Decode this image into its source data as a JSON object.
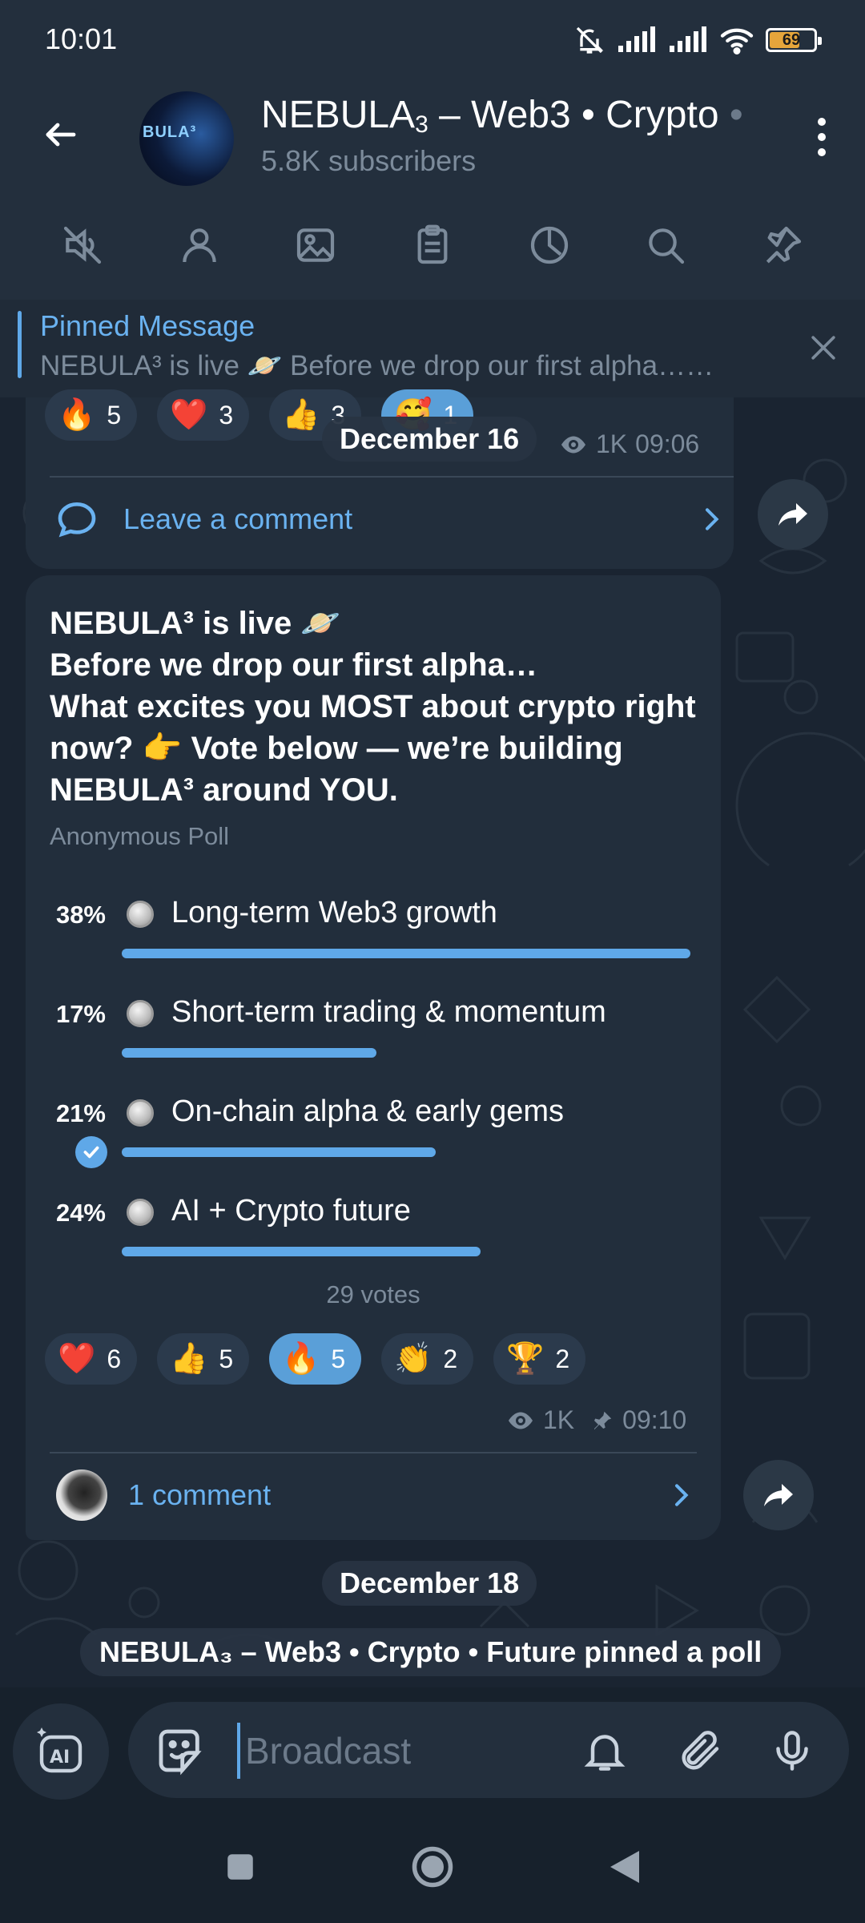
{
  "status_bar": {
    "time": "10:01",
    "battery": "69",
    "battery_level": 0.69
  },
  "channel": {
    "avatar_text": "BULA³",
    "name": "NEBULA",
    "name_sub": "3",
    "name_rest": " – Web3 • Crypto",
    "name_fade": " •",
    "subscribers": "5.8K subscribers"
  },
  "tabs": [
    "mute-icon",
    "members-icon",
    "media-icon",
    "files-icon",
    "stats-icon",
    "search-icon",
    "pin-icon"
  ],
  "pinned": {
    "title": "Pinned Message",
    "text": "NEBULA³ is live 🪐 Before we drop our first alpha……"
  },
  "prev_message": {
    "reactions": [
      {
        "emoji": "🔥",
        "count": "5"
      },
      {
        "emoji": "❤️",
        "count": "3"
      },
      {
        "emoji": "👍",
        "count": "3"
      },
      {
        "emoji": "🥰",
        "count": "1"
      }
    ],
    "date_chip": "December 16",
    "views": "1K",
    "time": "09:06",
    "comment_label": "Leave a comment"
  },
  "poll": {
    "question": "NEBULA³ is live 🪐\nBefore we drop our first alpha…\n What excites you MOST about crypto right now? 👉 Vote below — we’re building NEBULA³ around YOU.",
    "type": "Anonymous Poll",
    "options": [
      {
        "pct": "38%",
        "text": "Long-term Web3 growth",
        "value": 38
      },
      {
        "pct": "17%",
        "text": "Short-term trading & momentum",
        "value": 17
      },
      {
        "pct": "21%",
        "text": "On-chain alpha & early gems",
        "value": 21,
        "chosen": true
      },
      {
        "pct": "24%",
        "text": "AI + Crypto future",
        "value": 24
      }
    ],
    "votes": "29 votes",
    "reactions": [
      {
        "emoji": "❤️",
        "count": "6"
      },
      {
        "emoji": "👍",
        "count": "5"
      },
      {
        "emoji": "🔥",
        "count": "5",
        "active": true
      },
      {
        "emoji": "👏",
        "count": "2"
      },
      {
        "emoji": "🏆",
        "count": "2"
      }
    ],
    "views": "1K",
    "time": "09:10",
    "comment_label": "1 comment"
  },
  "date_chip_2": "December 18",
  "service_message": "NEBULA₃ – Web3 • Crypto • Future pinned a poll",
  "input": {
    "placeholder": "Broadcast"
  },
  "colors": {
    "accent": "#5fa8e8",
    "bubble": "#222e3c",
    "header": "#232f3d"
  }
}
